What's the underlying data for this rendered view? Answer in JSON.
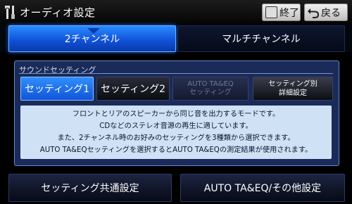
{
  "header": {
    "title": "オーディオ設定",
    "exit_label": "終了",
    "back_label": "戻る",
    "icons": [
      "wrench-screwdriver-icon",
      "exit-icon",
      "back-arrow-icon"
    ]
  },
  "tabs": [
    {
      "label": "2チャンネル",
      "active": true
    },
    {
      "label": "マルチチャンネル",
      "active": false
    }
  ],
  "sound_setting": {
    "title": "サウンドセッティング",
    "buttons": [
      {
        "line1": "セッティング1",
        "line2": "",
        "state": "selected"
      },
      {
        "line1": "セッティング2",
        "line2": "",
        "state": "normal"
      },
      {
        "line1": "AUTO TA&EQ",
        "line2": "セッティング",
        "state": "disabled"
      },
      {
        "line1": "セッティング別",
        "line2": "詳細設定",
        "state": "normal"
      }
    ],
    "description": [
      "フロントとリアのスピーカーから同じ音を出力するモードです。",
      "CDなどのステレオ音源の再生に適しています。",
      "また、2チャンネル時のお好みのセッティングを3種類から選択できます。",
      "AUTO TA&EQセッティングを選択するとAUTO TA&EQの測定結果が使用されます。"
    ]
  },
  "footer": {
    "common_settings": "セッティング共通設定",
    "auto_taeq_other": "AUTO TA&EQ/その他設定"
  },
  "colors": {
    "accent_blue": "#1e6dff",
    "panel_bg": "#1a2b5a",
    "description_bg": "#cfe1f4"
  }
}
